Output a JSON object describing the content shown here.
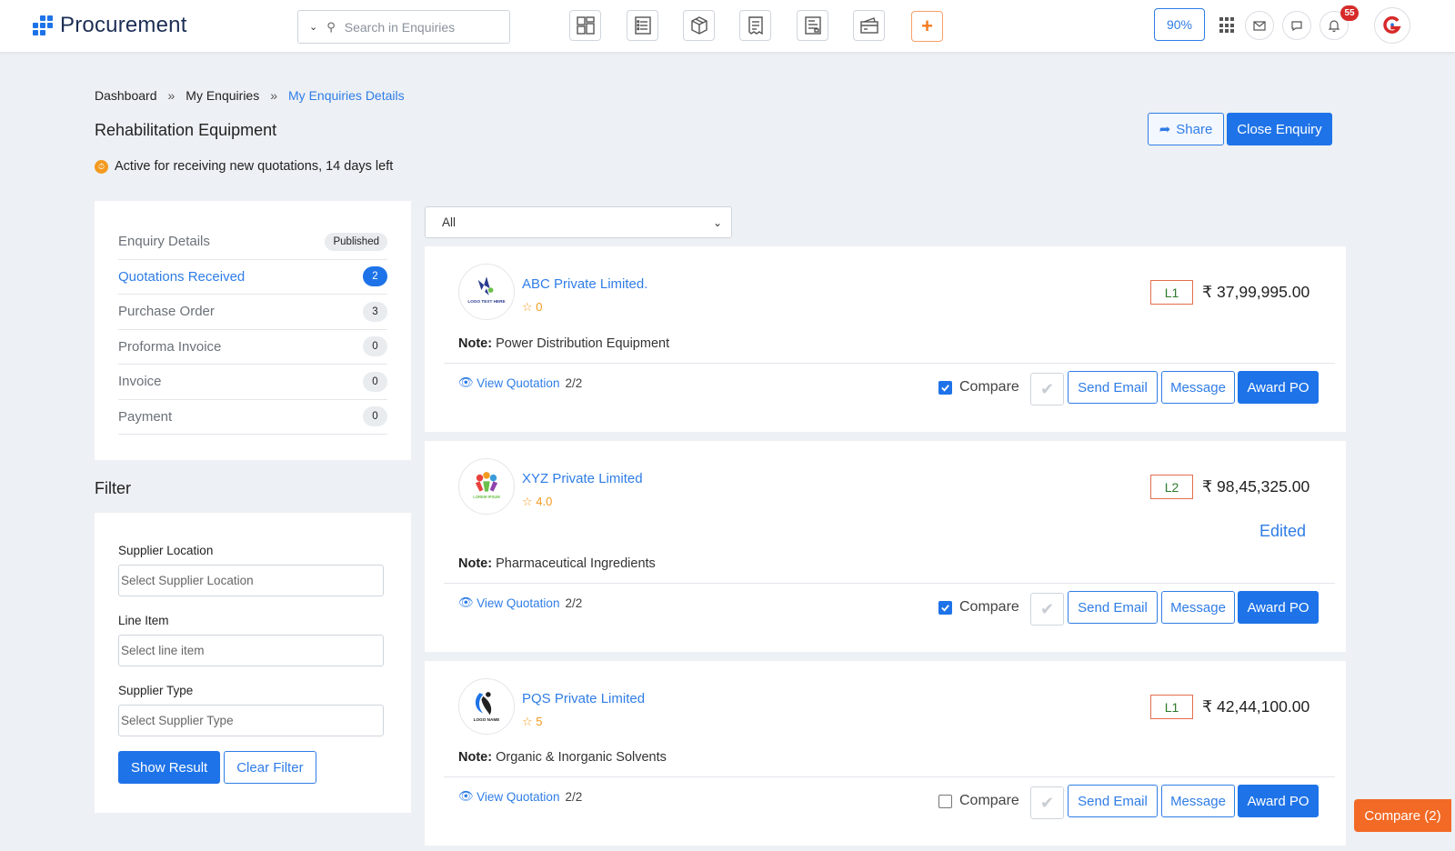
{
  "app": {
    "title": "Procurement"
  },
  "search": {
    "placeholder": "Search in Enquiries"
  },
  "header": {
    "zoom": "90%",
    "notification_count": "55"
  },
  "breadcrumb": {
    "items": [
      "Dashboard",
      "My Enquiries",
      "My Enquiries Details"
    ],
    "separator": "»"
  },
  "page": {
    "title": "Rehabilitation Equipment",
    "status": "Active for receiving new quotations, 14 days left",
    "share_label": "Share",
    "close_label": "Close Enquiry"
  },
  "menu": {
    "items": [
      {
        "label": "Enquiry Details",
        "badge": "Published"
      },
      {
        "label": "Quotations Received",
        "badge": "2"
      },
      {
        "label": "Purchase Order",
        "badge": "3"
      },
      {
        "label": "Proforma Invoice",
        "badge": "0"
      },
      {
        "label": "Invoice",
        "badge": "0"
      },
      {
        "label": "Payment",
        "badge": "0"
      }
    ]
  },
  "filter": {
    "title": "Filter",
    "location_label": "Supplier Location",
    "location_placeholder": "Select Supplier Location",
    "line_item_label": "Line Item",
    "line_item_placeholder": "Select line item",
    "type_label": "Supplier Type",
    "type_placeholder": "Select Supplier Type",
    "show_label": "Show Result",
    "clear_label": "Clear Filter"
  },
  "list_filter": {
    "selected": "All"
  },
  "quotes": [
    {
      "name": "ABC Private Limited.",
      "rating": "0",
      "rank": "L1",
      "price": "37,99,995.00",
      "note_label": "Note:",
      "note": "Power Distribution Equipment",
      "view_label": "View Quotation",
      "view_count": "2/2",
      "compare_label": "Compare",
      "compare_checked": true,
      "edited": "",
      "logo_text": "LOGO TEXT HERE"
    },
    {
      "name": "XYZ Private Limited",
      "rating": "4.0",
      "rank": "L2",
      "price": "98,45,325.00",
      "note_label": "Note:",
      "note": "Pharmaceutical Ingredients",
      "view_label": "View Quotation",
      "view_count": "2/2",
      "compare_label": "Compare",
      "compare_checked": true,
      "edited": "Edited",
      "logo_text": "LOREM IPSUM"
    },
    {
      "name": "PQS Private Limited",
      "rating": "5",
      "rank": "L1",
      "price": "42,44,100.00",
      "note_label": "Note:",
      "note": "Organic & Inorganic Solvents",
      "view_label": "View Quotation",
      "view_count": "2/2",
      "compare_label": "Compare",
      "compare_checked": false,
      "edited": "",
      "logo_text": "LOGO NAME"
    }
  ],
  "actions": {
    "email_label": "Send Email",
    "message_label": "Message",
    "award_label": "Award PO"
  },
  "compare_float": {
    "label": "Compare (2)"
  },
  "currency_symbol": "₹",
  "colors": {
    "primary": "#1e73e8",
    "accent": "#f26a25",
    "warning": "#f39a1f",
    "rank_border": "#e46e4d"
  }
}
